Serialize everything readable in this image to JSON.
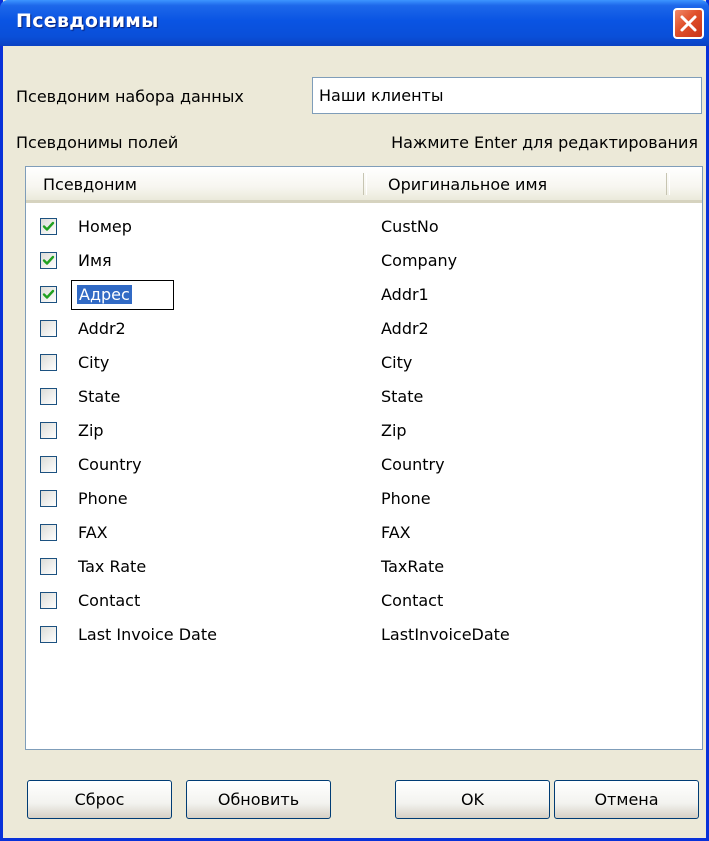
{
  "window": {
    "title": "Псевдонимы"
  },
  "dataset": {
    "label": "Псевдоним набора данных",
    "value": "Наши клиенты"
  },
  "fields": {
    "label": "Псевдонимы полей",
    "hint": "Нажмите Enter для редактирования"
  },
  "table": {
    "columns": [
      "Псевдоним",
      "Оригинальное имя"
    ],
    "rows": [
      {
        "alias": "Номер",
        "original": "CustNo",
        "checked": true
      },
      {
        "alias": "Имя",
        "original": "Company",
        "checked": true
      },
      {
        "alias": "Адрес",
        "original": "Addr1",
        "checked": true,
        "editing": true
      },
      {
        "alias": "Addr2",
        "original": "Addr2",
        "checked": false
      },
      {
        "alias": "City",
        "original": "City",
        "checked": false
      },
      {
        "alias": "State",
        "original": "State",
        "checked": false
      },
      {
        "alias": "Zip",
        "original": "Zip",
        "checked": false
      },
      {
        "alias": "Country",
        "original": "Country",
        "checked": false
      },
      {
        "alias": "Phone",
        "original": "Phone",
        "checked": false
      },
      {
        "alias": "FAX",
        "original": "FAX",
        "checked": false
      },
      {
        "alias": "Tax Rate",
        "original": "TaxRate",
        "checked": false
      },
      {
        "alias": "Contact",
        "original": "Contact",
        "checked": false
      },
      {
        "alias": "Last Invoice Date",
        "original": "LastInvoiceDate",
        "checked": false
      }
    ]
  },
  "buttons": {
    "reset": "Сброс",
    "refresh": "Обновить",
    "ok": "OK",
    "cancel": "Отмена"
  },
  "icons": {
    "close": "close-icon",
    "check": "check-icon"
  },
  "colors": {
    "titlebar": "#0a54e3",
    "frame": "#0831d9",
    "close": "#e0502a",
    "check": "#21a121",
    "selection": "#316ac5"
  }
}
